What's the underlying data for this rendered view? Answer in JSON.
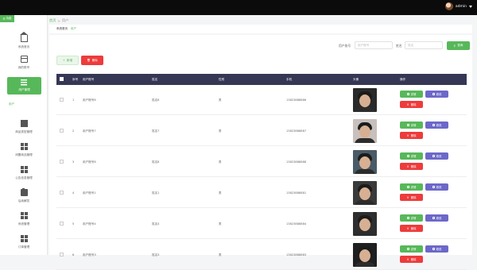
{
  "topbar": {
    "username": "admin"
  },
  "sidebar": {
    "head_label": "功能",
    "items": [
      {
        "label": "系统首页",
        "icon": "home-icon"
      },
      {
        "label": "我的账号",
        "icon": "window-icon"
      },
      {
        "label": "用户管理",
        "icon": "list-icon",
        "active": true
      },
      {
        "label": "商品类型管理",
        "icon": "square-icon"
      },
      {
        "label": "闲置商品管理",
        "icon": "grid-icon"
      },
      {
        "label": "公告信息管理",
        "icon": "grid-icon"
      },
      {
        "label": "后续解答",
        "icon": "clipboard-icon"
      },
      {
        "label": "系统管理",
        "icon": "grid-icon"
      },
      {
        "label": "订单管理",
        "icon": "grid-icon"
      }
    ],
    "sub_item": "用户"
  },
  "breadcrumb": {
    "home": "首页",
    "sep": ">",
    "current": "用户"
  },
  "subcrumb": {
    "first": "系统首页",
    "second": "用户"
  },
  "filter": {
    "account_label": "用户账号",
    "account_placeholder": "用户账号",
    "name_label": "姓名",
    "name_placeholder": "姓名",
    "search_label": "查询"
  },
  "actions": {
    "add_label": "新增",
    "delete_label": "删除"
  },
  "table": {
    "columns": [
      "序号",
      "用户账号",
      "姓名",
      "性别",
      "手机",
      "头像",
      "操作"
    ],
    "detail_label": "详情",
    "edit_label": "修改",
    "delete_label": "删除",
    "rows": [
      {
        "index": "1",
        "account": "用户账号6",
        "name": "姓名6",
        "gender": "男",
        "phone": "13823888886"
      },
      {
        "index": "2",
        "account": "用户账号7",
        "name": "姓名7",
        "gender": "男",
        "phone": "13823888887"
      },
      {
        "index": "3",
        "account": "用户账号8",
        "name": "姓名8",
        "gender": "男",
        "phone": "13823888888"
      },
      {
        "index": "4",
        "account": "用户账号1",
        "name": "姓名1",
        "gender": "男",
        "phone": "13823888881"
      },
      {
        "index": "5",
        "account": "用户账号4",
        "name": "姓名4",
        "gender": "男",
        "phone": "13823888884"
      },
      {
        "index": "6",
        "account": "用户账号3",
        "name": "姓名3",
        "gender": "男",
        "phone": "13823888883"
      }
    ]
  },
  "colors": {
    "accent": "#57b85a",
    "danger": "#ee3b3b",
    "edit": "#6c68c9",
    "table_header": "#353755"
  }
}
